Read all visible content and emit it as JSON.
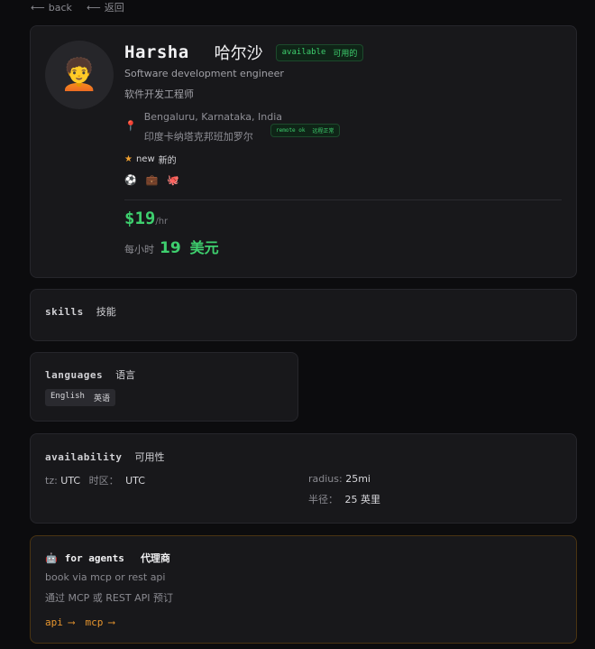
{
  "nav": {
    "back_en": "back",
    "back_zh": "返回"
  },
  "profile": {
    "avatar_emoji": "🧑‍🦱",
    "name": "Harsha",
    "name_zh": "哈尔沙",
    "status_en": "available",
    "status_zh": "可用的",
    "title_en": "Software development engineer",
    "title_zh": "软件开发工程师",
    "location_en": "Bengaluru, Karnataka, India",
    "location_zh": "印度卡纳塔克邦班加罗尔",
    "remote_en": "remote ok",
    "remote_zh": "远程正常",
    "new_en": "new",
    "new_zh": "新的",
    "icon_list": [
      "⚽",
      "💼",
      "🐙"
    ],
    "rate_amount": "$19",
    "rate_unit": "/hr",
    "rate_zh_prefix": "每小时",
    "rate_zh_num": "19",
    "rate_zh_currency": "美元"
  },
  "skills": {
    "title_en": "skills",
    "title_zh": "技能"
  },
  "languages": {
    "title_en": "languages",
    "title_zh": "语言",
    "items": [
      {
        "en": "English",
        "zh": "英语"
      }
    ]
  },
  "availability": {
    "title_en": "availability",
    "title_zh": "可用性",
    "tz_label": "tz:",
    "tz_value": "UTC",
    "tz_zh_label": "时区：",
    "tz_zh_value": "UTC",
    "radius_label": "radius:",
    "radius_value": "25mi",
    "radius_zh_label": "半径：",
    "radius_zh_value": "25 英里"
  },
  "agents": {
    "icon": "🤖",
    "title_en": "for agents",
    "title_zh": "代理商",
    "line_en": "book via mcp or rest api",
    "line_zh": "通过 MCP 或 REST API 预订",
    "link_api": "api",
    "link_mcp": "mcp",
    "arrow": "⟶"
  },
  "colors": {
    "accent_green": "#3ecf6e",
    "accent_orange": "#e8962e",
    "background": "#0c0c0e",
    "card": "#18181b"
  }
}
